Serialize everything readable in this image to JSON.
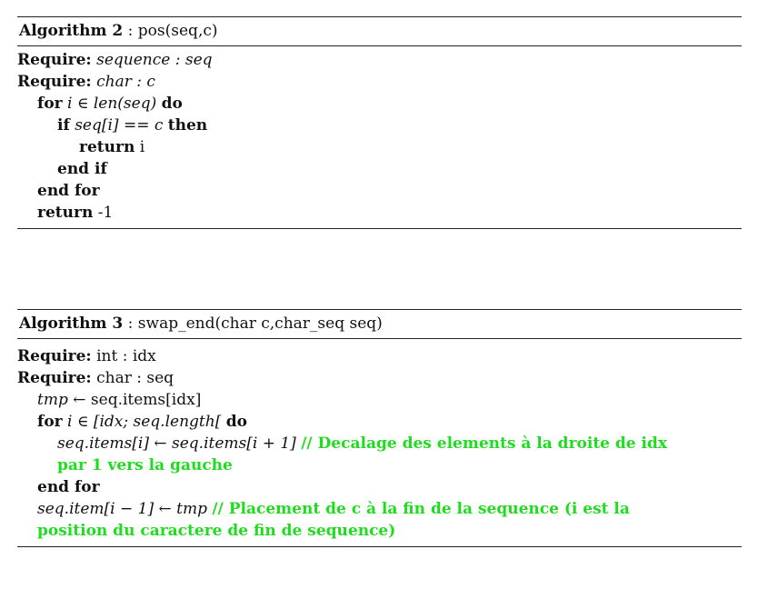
{
  "algo2": {
    "label": "Algorithm 2",
    "sep": ":",
    "signature": "pos(seq,c)",
    "lines": {
      "l1_kw": "Require:",
      "l1_txt": "sequence : seq",
      "l2_kw": "Require:",
      "l2_txt": "char : c",
      "l3_kw1": "for",
      "l3_txt": "i ∈ len(seq)",
      "l3_kw2": "do",
      "l4_kw1": "if",
      "l4_txt": "seq[i] == c",
      "l4_kw2": "then",
      "l5_kw": "return",
      "l5_txt": "i",
      "l6_kw": "end if",
      "l7_kw": "end for",
      "l8_kw": "return",
      "l8_txt": "-1"
    }
  },
  "algo3": {
    "label": "Algorithm 3",
    "sep": ":",
    "signature": "swap_end(char c,char_seq seq)",
    "lines": {
      "l1_kw": "Require:",
      "l1_txt": "int : idx",
      "l2_kw": "Require:",
      "l2_txt": "char : seq",
      "l3_var": "tmp",
      "l3_arrow": "←",
      "l3_txt": "seq.items[idx]",
      "l4_kw1": "for",
      "l4_txt": "i ∈ [idx; seq.length[",
      "l4_kw2": "do",
      "l5_code": "seq.items[i] ← seq.items[i + 1]",
      "l5_cmt": "// Decalage des elements à la droite de idx",
      "l6_cmt": "par 1 vers la gauche",
      "l7_kw": "end for",
      "l8_code": "seq.item[i − 1] ← tmp",
      "l8_cmt": "// Placement de c à la fin de la sequence (i est la",
      "l9_cmt": "position du caractere de fin de sequence)"
    }
  }
}
